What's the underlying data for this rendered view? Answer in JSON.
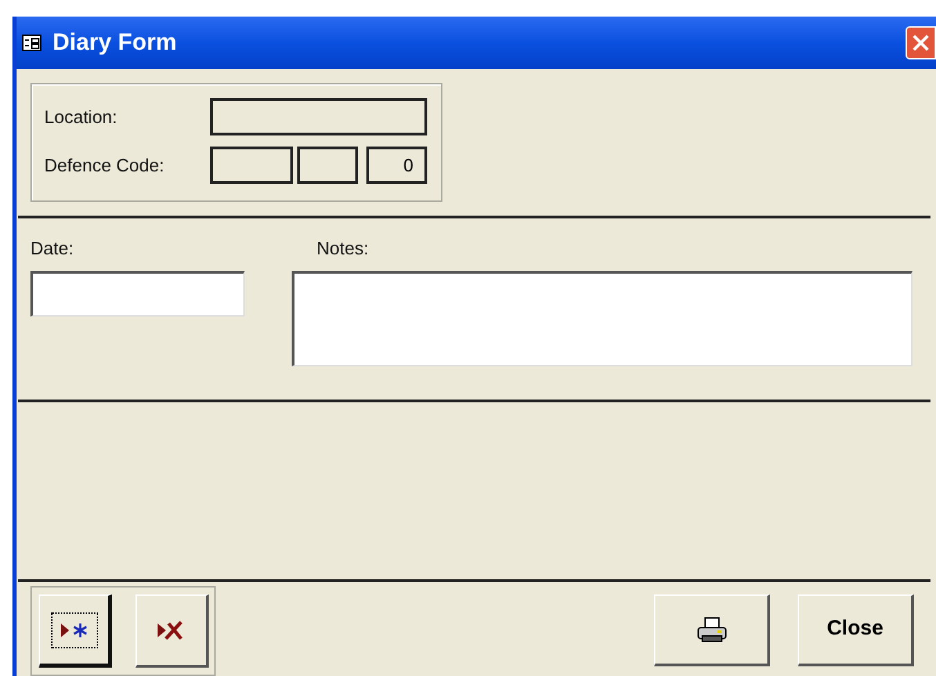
{
  "window": {
    "title": "Diary Form"
  },
  "location": {
    "label": "Location:"
  },
  "defence_code": {
    "label": "Defence Code:",
    "value": "0"
  },
  "date": {
    "label": "Date:"
  },
  "notes": {
    "label": "Notes:"
  },
  "record_buttons": [
    {
      "kind": "new",
      "focused": true
    },
    {
      "kind": "delete",
      "focused": false
    }
  ],
  "print_button": {
    "kind": "print"
  },
  "close_button": {
    "label": "Close"
  }
}
